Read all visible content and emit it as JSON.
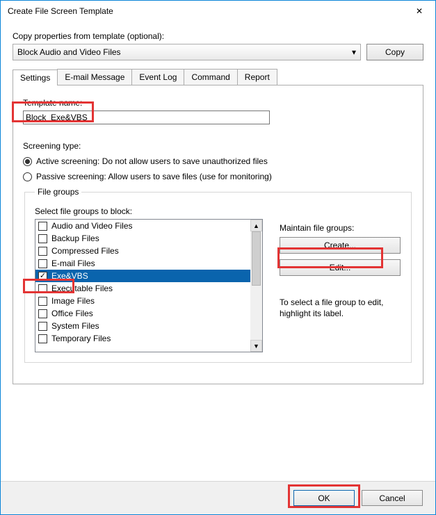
{
  "window": {
    "title": "Create File Screen Template",
    "close_icon": "✕"
  },
  "copy_label": "Copy properties from template (optional):",
  "template_dropdown": "Block Audio and Video Files",
  "copy_btn": "Copy",
  "tabs": [
    "Settings",
    "E-mail Message",
    "Event Log",
    "Command",
    "Report"
  ],
  "template_name_label": "Template name:",
  "template_name_value": "Block_Exe&VBS",
  "screening_type_label": "Screening type:",
  "active_label": "Active screening: Do not allow users to save unauthorized files",
  "passive_label": "Passive screening: Allow users to save files (use for monitoring)",
  "file_groups": {
    "legend": "File groups",
    "select_label": "Select file groups to block:",
    "items": [
      {
        "label": "Audio and Video Files",
        "checked": false,
        "selected": false
      },
      {
        "label": "Backup Files",
        "checked": false,
        "selected": false
      },
      {
        "label": "Compressed Files",
        "checked": false,
        "selected": false
      },
      {
        "label": "E-mail Files",
        "checked": false,
        "selected": false
      },
      {
        "label": "Exe&VBS",
        "checked": true,
        "selected": true
      },
      {
        "label": "Executable Files",
        "checked": false,
        "selected": false
      },
      {
        "label": "Image Files",
        "checked": false,
        "selected": false
      },
      {
        "label": "Office Files",
        "checked": false,
        "selected": false
      },
      {
        "label": "System Files",
        "checked": false,
        "selected": false
      },
      {
        "label": "Temporary Files",
        "checked": false,
        "selected": false
      }
    ],
    "maintain_label": "Maintain file groups:",
    "create_btn": "Create...",
    "edit_btn": "Edit...",
    "help": "To select a file group to edit, highlight its label."
  },
  "footer": {
    "ok": "OK",
    "cancel": "Cancel"
  }
}
